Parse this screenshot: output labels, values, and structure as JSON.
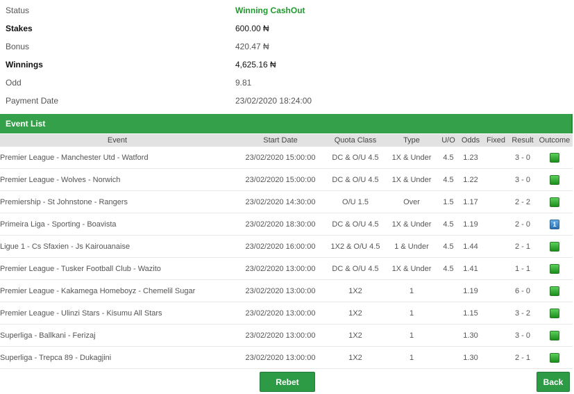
{
  "summary": [
    {
      "label": "Status",
      "value": "Winning CashOut"
    },
    {
      "label": "Stakes",
      "value": "600.00 ₦"
    },
    {
      "label": "Bonus",
      "value": "420.47 ₦"
    },
    {
      "label": "Winnings",
      "value": "4,625.16 ₦"
    },
    {
      "label": "Odd",
      "value": "9.81"
    },
    {
      "label": "Payment Date",
      "value": "23/02/2020 18:24:00"
    }
  ],
  "event_list": {
    "title": "Event List",
    "columns": [
      "Event",
      "Start Date",
      "Quota Class",
      "Type",
      "U/O",
      "Odds",
      "Fixed",
      "Result",
      "Outcome"
    ],
    "rows": [
      {
        "event": "Premier League - Manchester Utd - Watford",
        "start": "23/02/2020 15:00:00",
        "quota": "DC & O/U 4.5",
        "type": "1X & Under",
        "uo": "4.5",
        "odds": "1.23",
        "fixed": "",
        "result": "3 - 0",
        "outcome": "green-check-icon"
      },
      {
        "event": "Premier League - Wolves - Norwich",
        "start": "23/02/2020 15:00:00",
        "quota": "DC & O/U 4.5",
        "type": "1X & Under",
        "uo": "4.5",
        "odds": "1.22",
        "fixed": "",
        "result": "3 - 0",
        "outcome": "green-check-icon"
      },
      {
        "event": "Premiership - St Johnstone - Rangers",
        "start": "23/02/2020 14:30:00",
        "quota": "O/U 1.5",
        "type": "Over",
        "uo": "1.5",
        "odds": "1.17",
        "fixed": "",
        "result": "2 - 2",
        "outcome": "green-check-icon"
      },
      {
        "event": "Primeira Liga - Sporting - Boavista",
        "start": "23/02/2020 18:30:00",
        "quota": "DC & O/U 4.5",
        "type": "1X & Under",
        "uo": "4.5",
        "odds": "1.19",
        "fixed": "",
        "result": "2 - 0",
        "outcome": "number-one-icon"
      },
      {
        "event": "Ligue 1 - Cs Sfaxien - Js Kairouanaise",
        "start": "23/02/2020 16:00:00",
        "quota": "1X2 & O/U 4.5",
        "type": "1 & Under",
        "uo": "4.5",
        "odds": "1.44",
        "fixed": "",
        "result": "2 - 1",
        "outcome": "green-check-icon"
      },
      {
        "event": "Premier League - Tusker Football Club - Wazito",
        "start": "23/02/2020 13:00:00",
        "quota": "DC & O/U 4.5",
        "type": "1X & Under",
        "uo": "4.5",
        "odds": "1.41",
        "fixed": "",
        "result": "1 - 1",
        "outcome": "green-check-icon"
      },
      {
        "event": "Premier League - Kakamega Homeboyz - Chemelil Sugar",
        "start": "23/02/2020 13:00:00",
        "quota": "1X2",
        "type": "1",
        "uo": "",
        "odds": "1.19",
        "fixed": "",
        "result": "6 - 0",
        "outcome": "green-check-icon"
      },
      {
        "event": "Premier League - Ulinzi Stars - Kisumu All Stars",
        "start": "23/02/2020 13:00:00",
        "quota": "1X2",
        "type": "1",
        "uo": "",
        "odds": "1.15",
        "fixed": "",
        "result": "3 - 2",
        "outcome": "green-check-icon"
      },
      {
        "event": "Superliga - Ballkani - Ferizaj",
        "start": "23/02/2020 13:00:00",
        "quota": "1X2",
        "type": "1",
        "uo": "",
        "odds": "1.30",
        "fixed": "",
        "result": "3 - 0",
        "outcome": "green-check-icon"
      },
      {
        "event": "Superliga - Trepca 89 - Dukagjini",
        "start": "23/02/2020 13:00:00",
        "quota": "1X2",
        "type": "1",
        "uo": "",
        "odds": "1.30",
        "fixed": "",
        "result": "2 - 1",
        "outcome": "green-check-icon"
      }
    ]
  },
  "buttons": {
    "rebet": "Rebet",
    "back": "Back"
  },
  "colors": {
    "accent": "#34a049",
    "win_text": "#1f9a2c",
    "header_row": "#e2e2e2"
  }
}
